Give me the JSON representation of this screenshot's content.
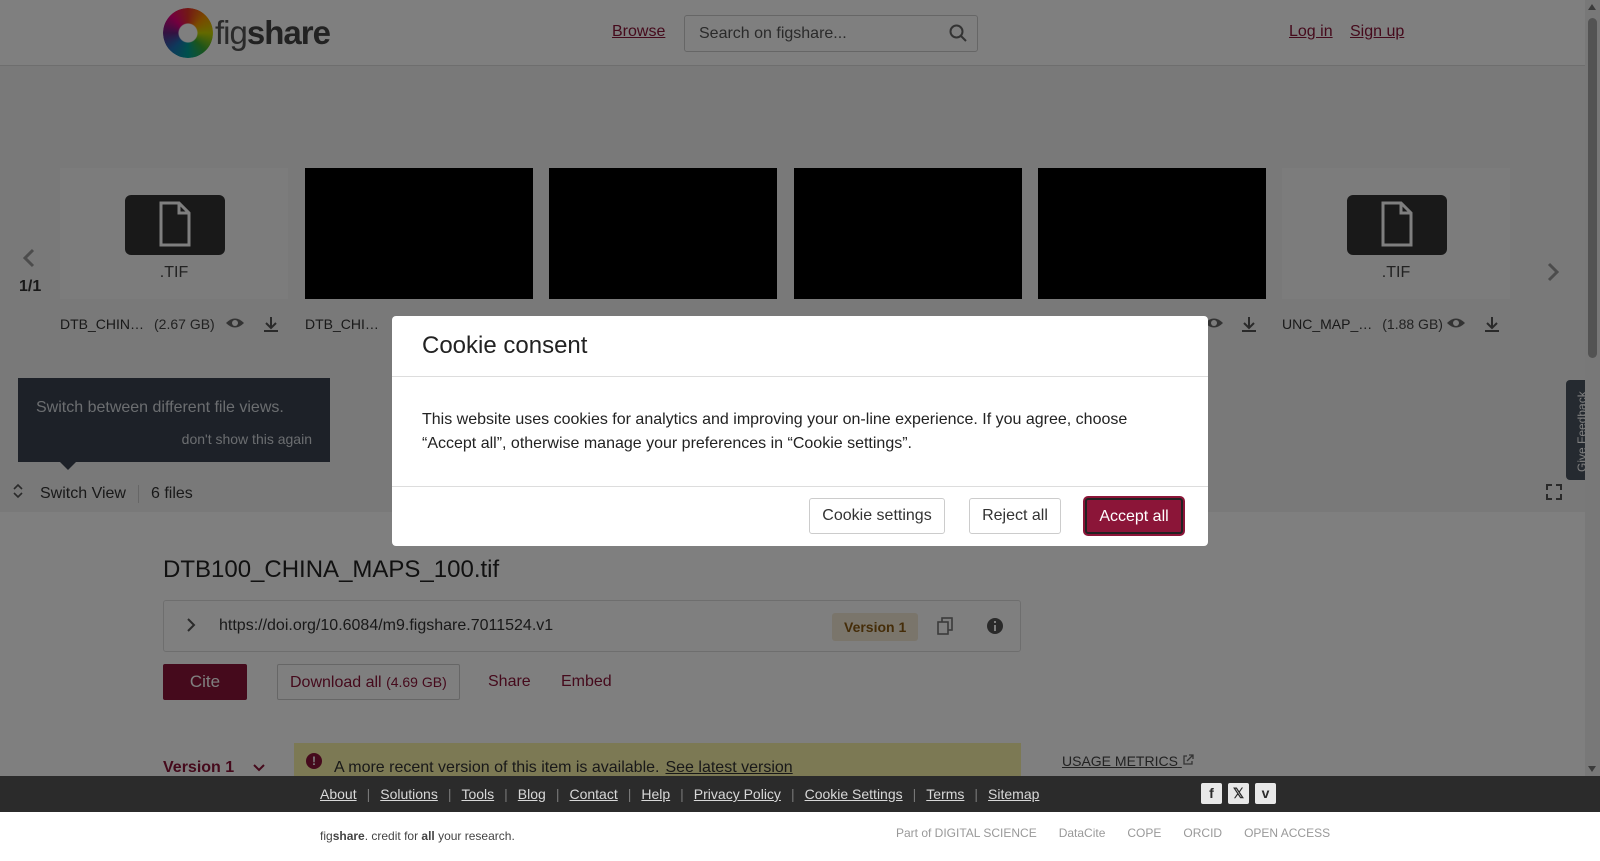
{
  "header": {
    "logo_text": "fig",
    "logo_text_bold": "share",
    "browse": "Browse",
    "search_placeholder": "Search on figshare...",
    "login": "Log in",
    "signup": "Sign up"
  },
  "carousel": {
    "pager": "1/1",
    "items": [
      {
        "type": "icon",
        "ext": ".TIF",
        "name": "DTB_CHIN…",
        "size": "(2.67 GB)"
      },
      {
        "type": "image",
        "name": "DTB_CHI…"
      },
      {
        "type": "image"
      },
      {
        "type": "image"
      },
      {
        "type": "image"
      },
      {
        "type": "icon",
        "ext": ".TIF",
        "name": "UNC_MAP_…",
        "size": "(1.88 GB)"
      }
    ]
  },
  "tooltip": {
    "text": "Switch between different file views.",
    "dismiss": "don't show this again"
  },
  "view_bar": {
    "switch_view": "Switch View",
    "files_count": "6 files"
  },
  "feedback": "Give Feedback",
  "item": {
    "title": "DTB100_CHINA_MAPS_100.tif",
    "doi": "https://doi.org/10.6084/m9.figshare.7011524.v1",
    "version_badge": "Version 1",
    "cite": "Cite",
    "download_all": "Download all",
    "download_size": "(4.69 GB)",
    "share": "Share",
    "embed": "Embed",
    "version_dropdown": "Version 1",
    "banner_text": "A more recent version of this item is available.",
    "banner_link": "See latest version",
    "usage_metrics": "USAGE METRICS"
  },
  "cookie": {
    "title": "Cookie consent",
    "body": "This website uses cookies for analytics and improving your on-line experience. If you agree, choose “Accept all”, otherwise manage your preferences in “Cookie settings”.",
    "settings": "Cookie settings",
    "reject": "Reject all",
    "accept": "Accept all"
  },
  "footer": {
    "links": [
      "About",
      "Solutions",
      "Tools",
      "Blog",
      "Contact",
      "Help",
      "Privacy Policy",
      "Cookie Settings",
      "Terms",
      "Sitemap"
    ],
    "credit_fig": "fig",
    "credit_share": "share",
    "credit_mid": ". credit for ",
    "credit_all": "all",
    "credit_end": " your research.",
    "partner_logos": [
      "Part of DIGITAL SCIENCE",
      "DataCite",
      "COPE",
      "ORCID",
      "OPEN ACCESS"
    ]
  },
  "colors": {
    "brand": "#8b1538",
    "banner": "#f8f2a8",
    "tooltip": "#3a4350",
    "footer": "#2b2b2b"
  }
}
